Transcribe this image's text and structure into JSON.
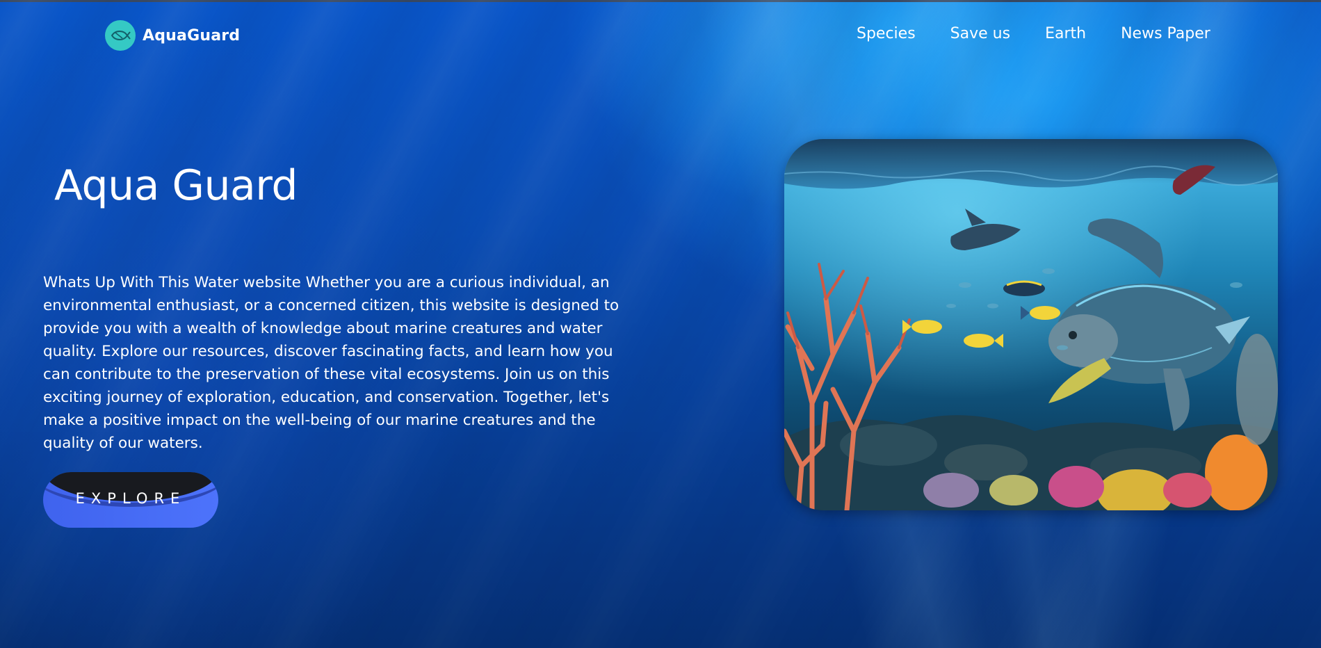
{
  "header": {
    "logo_text": "AquaGuard",
    "logo_icon": "fish-icon",
    "nav": [
      {
        "label": "Species"
      },
      {
        "label": "Save us"
      },
      {
        "label": "Earth"
      },
      {
        "label": "News Paper"
      }
    ]
  },
  "hero": {
    "title": "Aqua Guard",
    "description": "Whats Up With This Water website Whether you are a curious individual, an environmental enthusiast, or a concerned citizen, this website is designed to provide you with a wealth of knowledge about marine creatures and water quality. Explore our resources, discover fascinating facts, and learn how you can contribute to the preservation of these vital ecosystems. Join us on this exciting journey of exploration, education, and conservation. Together, let's make a positive impact on the well-being of our marine creatures and the quality of our waters.",
    "button_label": "EXPLORE"
  },
  "colors": {
    "logo_badge": "#35c9c4",
    "button": "#4a6ff5",
    "background_top": "#0a56c9",
    "background_bottom": "#062f73"
  }
}
